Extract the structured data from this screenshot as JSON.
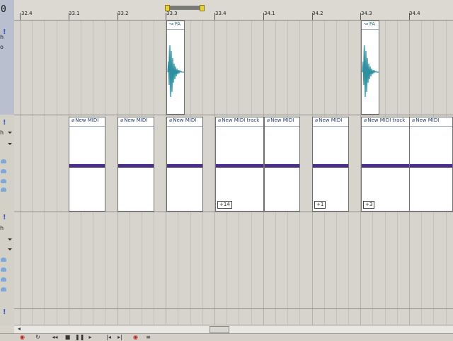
{
  "left_panel": {
    "counter": "0",
    "marks": [
      "!",
      "!",
      "!",
      "!"
    ],
    "short_labels": [
      "h",
      "o",
      "h",
      "h"
    ]
  },
  "ruler": {
    "labels": [
      "32.4",
      "33.1",
      "33.2",
      "33.3",
      "33.4",
      "34.1",
      "34.2",
      "34.3",
      "34.4"
    ]
  },
  "audio_clips": [
    {
      "label": "FA"
    },
    {
      "label": "FA"
    }
  ],
  "midi_clips": [
    {
      "label": "New MIDI",
      "badge": ""
    },
    {
      "label": "New MIDI",
      "badge": ""
    },
    {
      "label": "New MIDI",
      "badge": ""
    },
    {
      "label": "New MIDI track",
      "badge": "+14"
    },
    {
      "label": "New MIDI",
      "badge": ""
    },
    {
      "label": "New MIDI",
      "badge": "+1"
    },
    {
      "label": "New MIDI track",
      "badge": "+3"
    },
    {
      "label": "New MIDI",
      "badge": ""
    }
  ],
  "colors": {
    "waveform": "#2e8fa0",
    "midi_note": "#4a2e8a",
    "loop_marker": "#e8d040"
  },
  "icons": {
    "audio_clip": "audio-clip-icon",
    "midi_clip": "midi-clip-icon",
    "scroll_left": "arrow-left-icon",
    "record": "record-icon"
  }
}
